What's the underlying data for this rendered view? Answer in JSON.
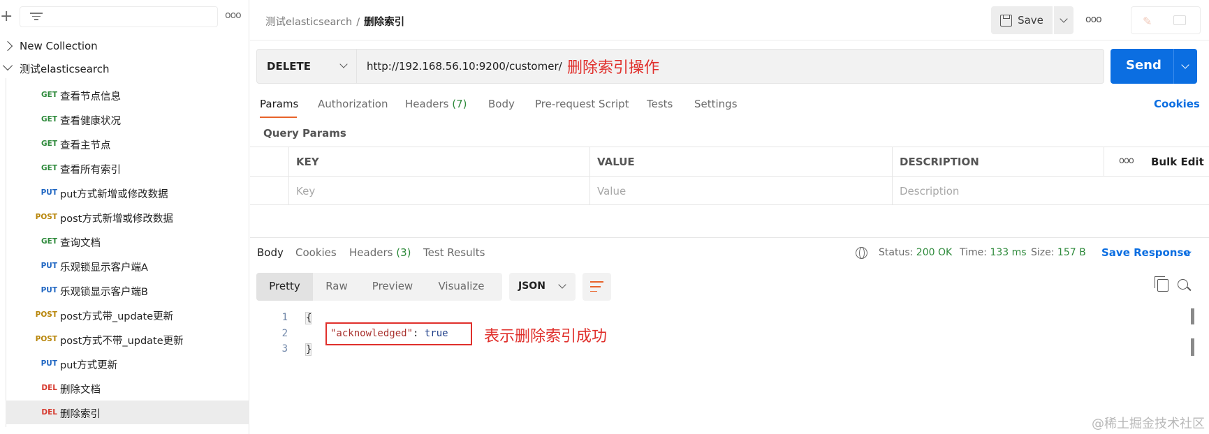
{
  "sidebar": {
    "collections": [
      {
        "name": "New Collection",
        "expanded": false
      },
      {
        "name": "测试elasticsearch",
        "expanded": true
      }
    ],
    "requests": [
      {
        "method": "GET",
        "name": "查看节点信息",
        "method_color": "#2e8a3b"
      },
      {
        "method": "GET",
        "name": "查看健康状况",
        "method_color": "#2e8a3b"
      },
      {
        "method": "GET",
        "name": "查看主节点",
        "method_color": "#2e8a3b"
      },
      {
        "method": "GET",
        "name": "查看所有索引",
        "method_color": "#2e8a3b"
      },
      {
        "method": "PUT",
        "name": "put方式新增或修改数据",
        "method_color": "#1f66c2"
      },
      {
        "method": "POST",
        "name": "post方式新增或修改数据",
        "method_color": "#b8860b"
      },
      {
        "method": "GET",
        "name": "查询文档",
        "method_color": "#2e8a3b"
      },
      {
        "method": "PUT",
        "name": "乐观锁显示客户端A",
        "method_color": "#1f66c2"
      },
      {
        "method": "PUT",
        "name": "乐观锁显示客户端B",
        "method_color": "#1f66c2"
      },
      {
        "method": "POST",
        "name": "post方式带_update更新",
        "method_color": "#b8860b"
      },
      {
        "method": "POST",
        "name": "post方式不带_update更新",
        "method_color": "#b8860b"
      },
      {
        "method": "PUT",
        "name": "put方式更新",
        "method_color": "#1f66c2"
      },
      {
        "method": "DEL",
        "name": "删除文档",
        "method_color": "#d63a2f"
      },
      {
        "method": "DEL",
        "name": "删除索引",
        "method_color": "#d63a2f",
        "active": true
      }
    ]
  },
  "header": {
    "breadcrumb_parent": "测试elasticsearch",
    "breadcrumb_sep": "/",
    "breadcrumb_current": "删除索引",
    "save_label": "Save"
  },
  "request": {
    "method": "DELETE",
    "url": "http://192.168.56.10:9200/customer/",
    "annotation": "删除索引操作",
    "send_label": "Send"
  },
  "tabs": {
    "params": "Params",
    "authorization": "Authorization",
    "headers": "Headers",
    "headers_count": "(7)",
    "body": "Body",
    "prerequest": "Pre-request Script",
    "tests": "Tests",
    "settings": "Settings",
    "cookies": "Cookies"
  },
  "query_params": {
    "title": "Query Params",
    "headers": {
      "key": "KEY",
      "value": "VALUE",
      "description": "DESCRIPTION",
      "bulk_edit": "Bulk Edit"
    },
    "placeholders": {
      "key": "Key",
      "value": "Value",
      "description": "Description"
    }
  },
  "response": {
    "tabs": {
      "body": "Body",
      "cookies": "Cookies",
      "headers": "Headers",
      "headers_count": "(3)",
      "test_results": "Test Results"
    },
    "status_label": "Status:",
    "status_value": "200 OK",
    "time_label": "Time:",
    "time_value": "133 ms",
    "size_label": "Size:",
    "size_value": "157 B",
    "save_response": "Save Response",
    "views": {
      "pretty": "Pretty",
      "raw": "Raw",
      "preview": "Preview",
      "visualize": "Visualize"
    },
    "format": "JSON",
    "lines": [
      "1",
      "2",
      "3"
    ],
    "open_brace": "{",
    "key": "\"acknowledged\"",
    "colon": ": ",
    "value": "true",
    "close_brace": "}",
    "annotation": "表示删除索引成功"
  },
  "watermark": "@稀土掘金技术社区",
  "colors": {
    "accent": "#e8632a",
    "primary": "#0b6ee1",
    "success": "#2e8a3b",
    "annotation": "#e0302c"
  }
}
